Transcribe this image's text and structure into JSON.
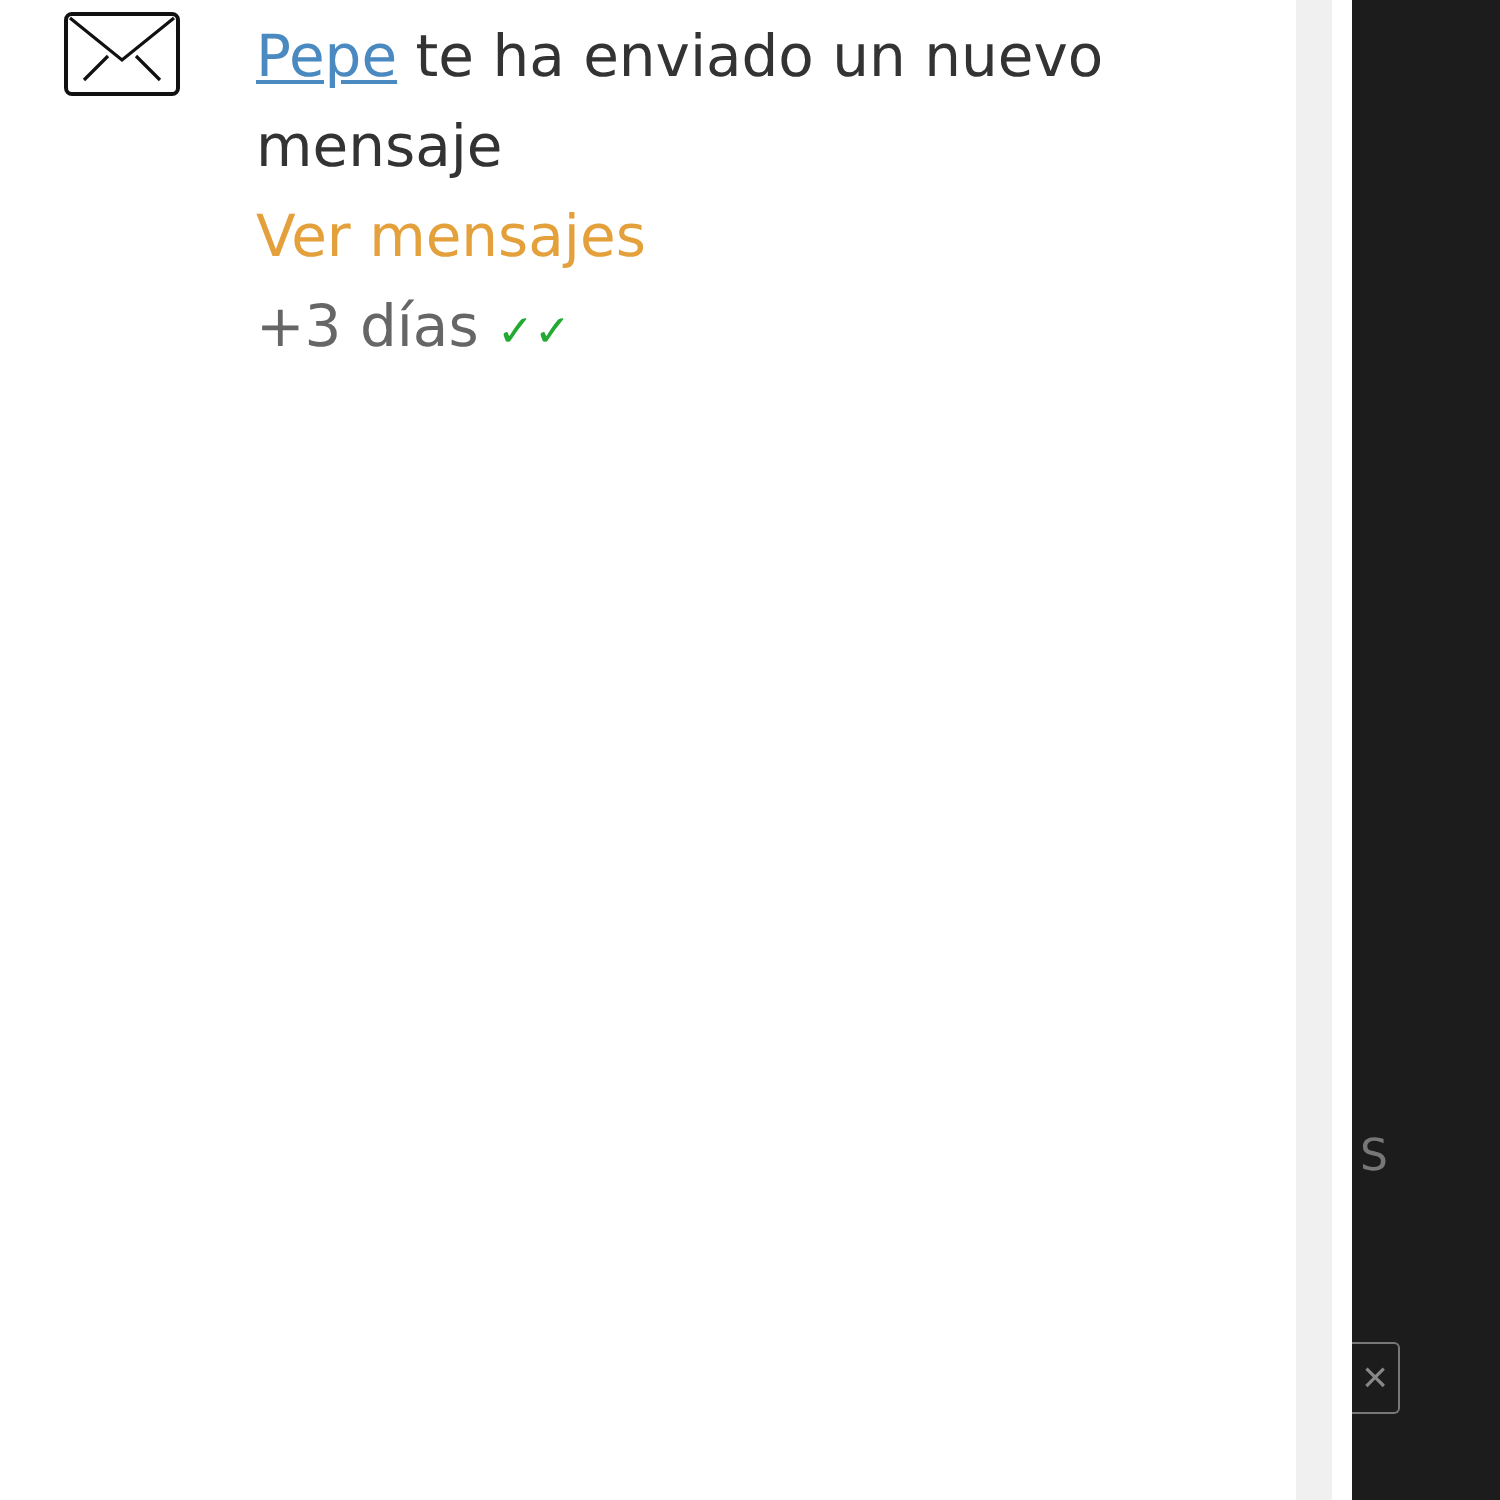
{
  "notification": {
    "sender": "Pepe",
    "message": " te ha enviado un nuevo mensaje",
    "action": "Ver mensajes",
    "time": "+3 días",
    "read_mark": "✓✓",
    "read": true
  },
  "background_panel": {
    "text": "S",
    "close": "×"
  }
}
